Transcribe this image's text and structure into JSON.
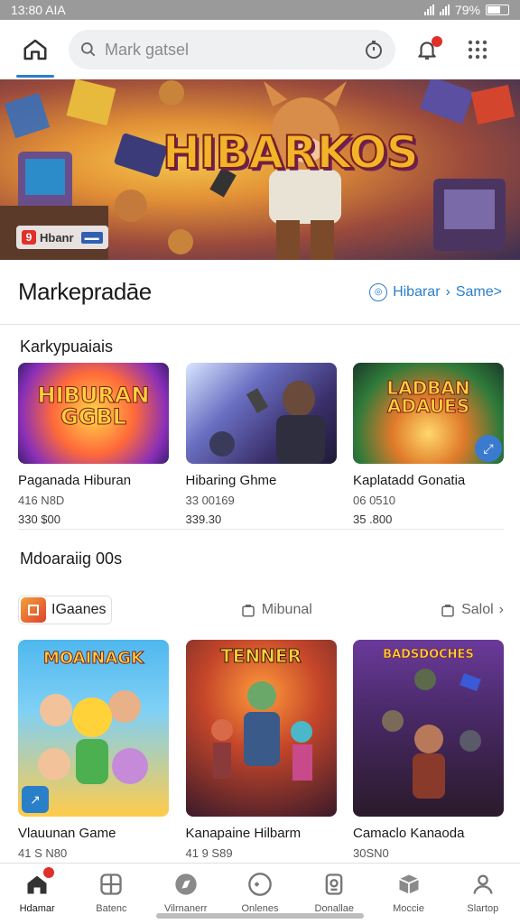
{
  "status_bar": {
    "time": "13:80 AIA",
    "battery": "79%"
  },
  "search": {
    "placeholder": "Mark gatsel"
  },
  "banner": {
    "title": "HIBARKOS",
    "badge_number": "9",
    "badge_text": "Hbanr"
  },
  "section": {
    "title": "Markepradāe",
    "link_label": "Hibarar",
    "link_more": "Same>"
  },
  "featured": {
    "heading": "Karkypuaiais",
    "items": [
      {
        "thumb_text": "HIBURAN GGBL",
        "title": "Paganada Hiburan",
        "meta": "416 N8D",
        "price": "330 $00"
      },
      {
        "thumb_text": "",
        "title": "Hibaring Ghme",
        "meta": "33 00169",
        "price": "339.30"
      },
      {
        "thumb_text": "LADBAN ADAUES",
        "title": "Kaplatadd Gonatia",
        "meta": "06 0510",
        "price": "35 .800"
      }
    ]
  },
  "recommended": {
    "heading": "Mdoaraiig 00s",
    "filters": {
      "chip_label": "IGaanes",
      "middle_label": "Mibunal",
      "right_label": "Salol"
    },
    "items": [
      {
        "thumb_text": "MOAINAGK",
        "title": "Vlauunan Game",
        "meta": "41 S N80"
      },
      {
        "thumb_text": "TENNER",
        "title": "Kanapaine Hilbarm",
        "meta": "41 9 S89"
      },
      {
        "thumb_text": "BADSDOCHES",
        "title": "Camaclo Kanaoda",
        "meta": "30SN0"
      }
    ]
  },
  "bottom_nav": [
    {
      "label": "Hdamar",
      "icon": "home-icon"
    },
    {
      "label": "Batenc",
      "icon": "grid-card-icon"
    },
    {
      "label": "Vilrnanerr",
      "icon": "compass-icon"
    },
    {
      "label": "Onlenes",
      "icon": "gamepad-icon"
    },
    {
      "label": "Donallae",
      "icon": "console-icon"
    },
    {
      "label": "Moccie",
      "icon": "box-icon"
    },
    {
      "label": "Slartop",
      "icon": "person-icon"
    }
  ],
  "colors": {
    "accent": "#2a7fc9",
    "badge": "#e0302a"
  }
}
